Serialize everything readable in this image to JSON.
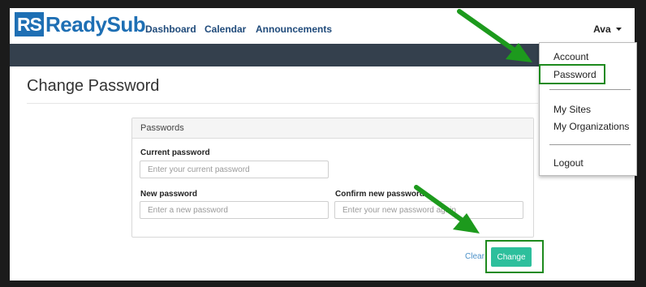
{
  "app": {
    "logo_mark": "RS",
    "logo_name": "ReadySub"
  },
  "nav": {
    "items": [
      {
        "label": "Dashboard"
      },
      {
        "label": "Calendar"
      },
      {
        "label": "Announcements"
      }
    ],
    "user_label": "Ava",
    "caret_icon": "caret-down-icon"
  },
  "user_dropdown": {
    "items": [
      {
        "label": "Account"
      },
      {
        "label": "Password"
      },
      {
        "label": "My Sites"
      },
      {
        "label": "My Organizations"
      },
      {
        "label": "Logout"
      }
    ]
  },
  "page": {
    "title": "Change Password"
  },
  "form": {
    "panel_heading": "Passwords",
    "current_password": {
      "label": "Current password",
      "placeholder": "Enter your current password",
      "value": ""
    },
    "new_password": {
      "label": "New password",
      "placeholder": "Enter a new password",
      "value": ""
    },
    "confirm_password": {
      "label": "Confirm new password",
      "placeholder": "Enter your new password again",
      "value": ""
    },
    "clear_label": "Clear",
    "change_label": "Change"
  },
  "annotations": {
    "highlight_color": "#1d8a1d",
    "arrow_icon": "green-arrow-icon"
  },
  "colors": {
    "brand": "#1e6fb4",
    "subbar": "#34404d",
    "button": "#2dbf9c",
    "link": "#4a90c8"
  }
}
